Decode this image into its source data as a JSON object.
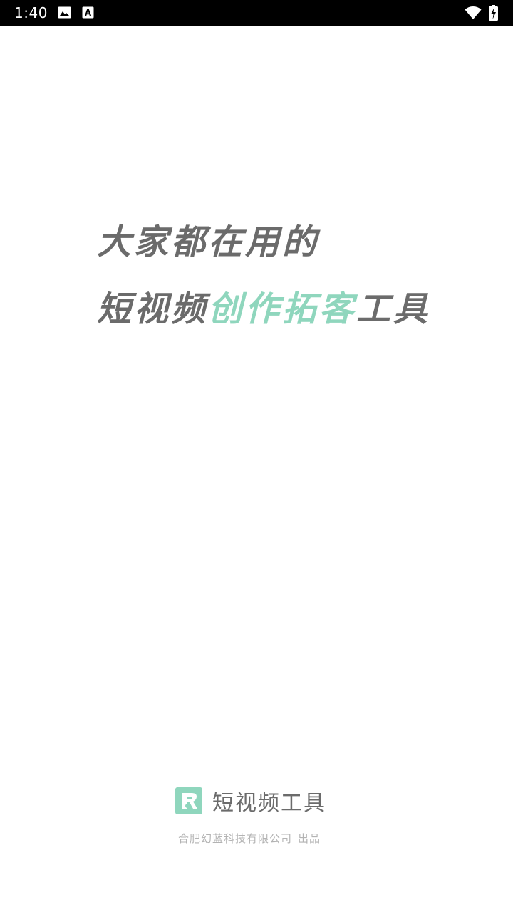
{
  "status_bar": {
    "time": "1:40",
    "icons": [
      "image-icon",
      "text-a-icon",
      "wifi-icon",
      "battery-charging-icon"
    ]
  },
  "slogan": {
    "line1": "大家都在用的",
    "line2_prefix": "短视频",
    "line2_accent": "创作拓客",
    "line2_suffix": "工具",
    "accent_color": "#8fd6bd",
    "text_color": "#6b6b6b"
  },
  "brand": {
    "logo": "app-logo-icon",
    "name": "短视频工具"
  },
  "credit": {
    "company": "合肥幻蓝科技有限公司",
    "suffix": "出品"
  }
}
